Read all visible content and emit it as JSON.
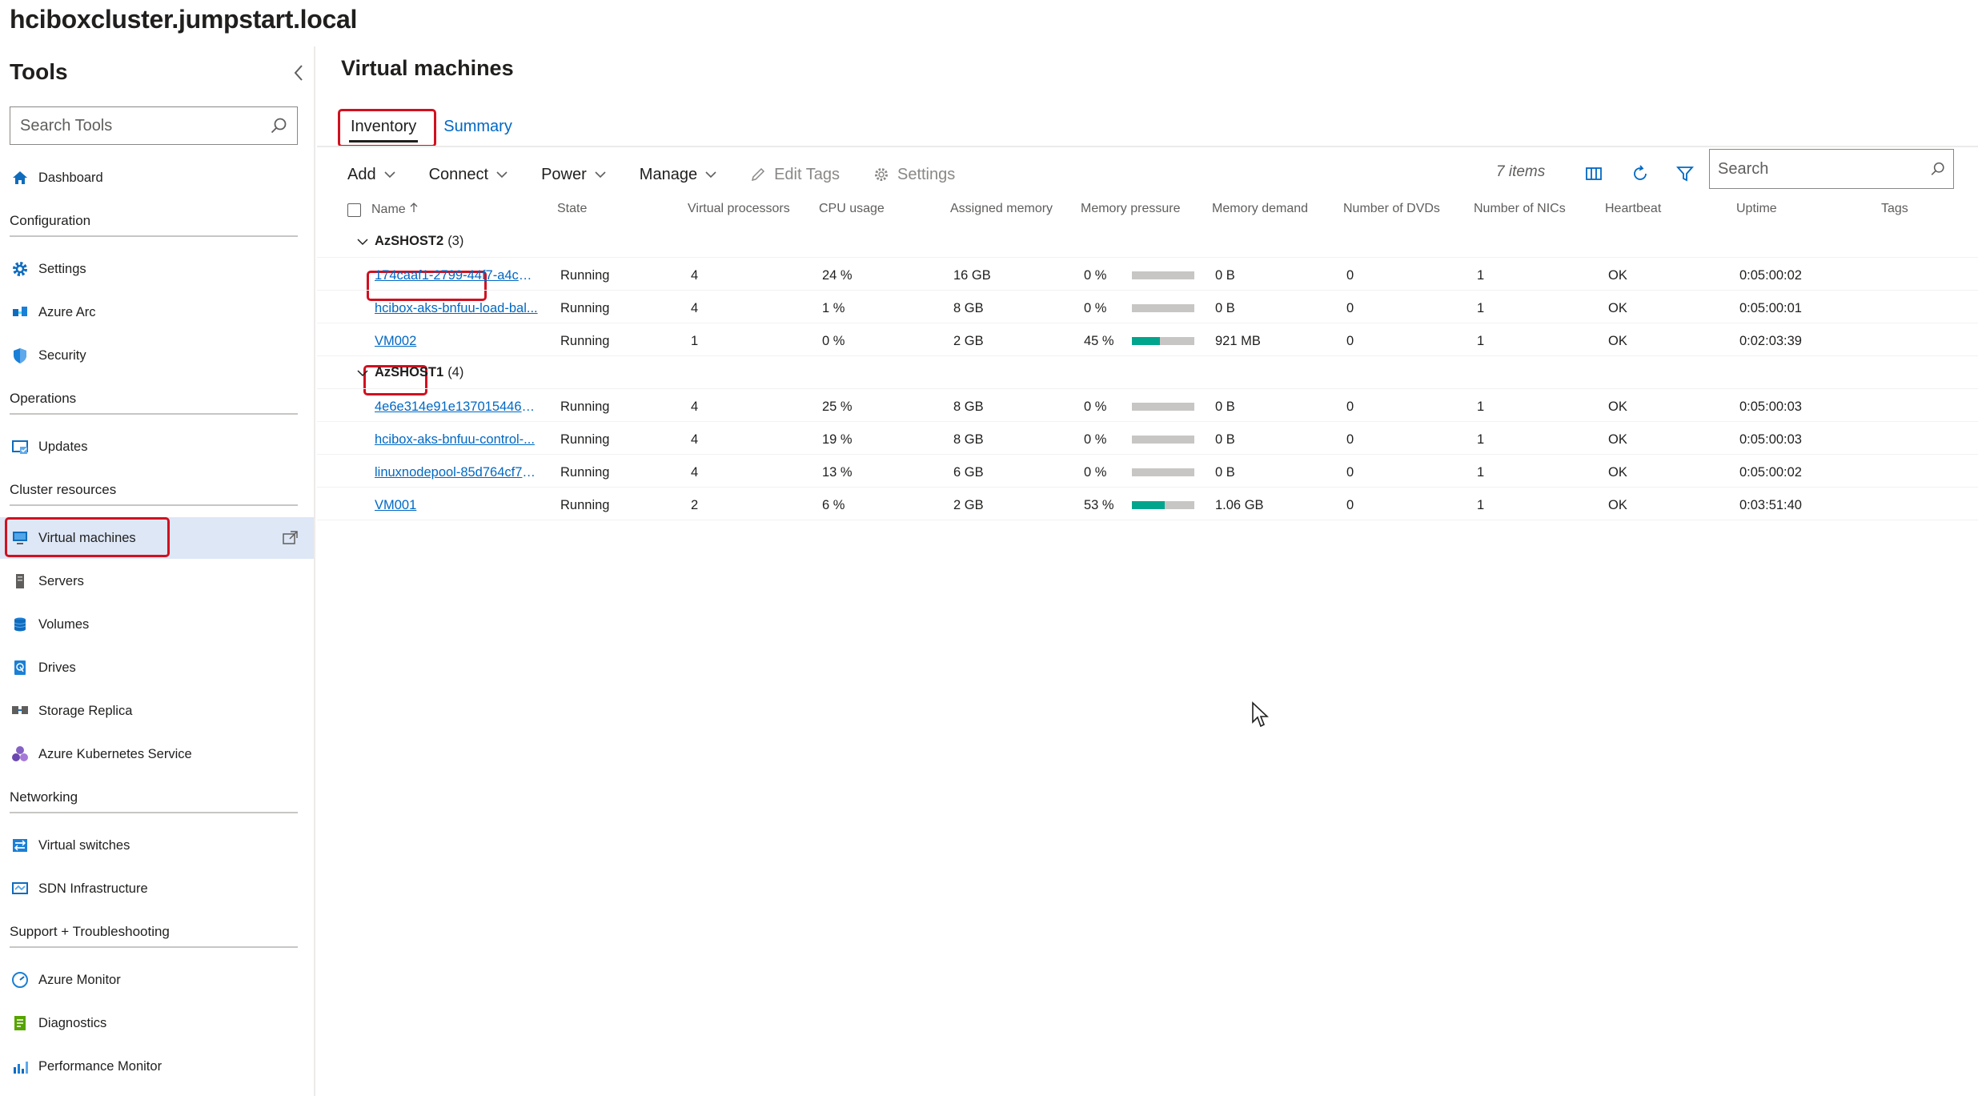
{
  "app": {
    "title": "hciboxcluster.jumpstart.local"
  },
  "sidebar": {
    "title": "Tools",
    "search_placeholder": "Search Tools",
    "items": {
      "dashboard": "Dashboard",
      "section_configuration": "Configuration",
      "settings": "Settings",
      "azure_arc": "Azure Arc",
      "security": "Security",
      "section_operations": "Operations",
      "updates": "Updates",
      "section_cluster_resources": "Cluster resources",
      "virtual_machines": "Virtual machines",
      "servers": "Servers",
      "volumes": "Volumes",
      "drives": "Drives",
      "storage_replica": "Storage Replica",
      "aks": "Azure Kubernetes Service",
      "section_networking": "Networking",
      "virtual_switches": "Virtual switches",
      "sdn_infrastructure": "SDN Infrastructure",
      "section_support": "Support + Troubleshooting",
      "azure_monitor": "Azure Monitor",
      "diagnostics": "Diagnostics",
      "performance_monitor": "Performance Monitor"
    }
  },
  "main": {
    "title": "Virtual machines",
    "tabs": [
      "Inventory",
      "Summary"
    ],
    "toolbar": {
      "add": "Add",
      "connect": "Connect",
      "power": "Power",
      "manage": "Manage",
      "edit_tags": "Edit Tags",
      "settings": "Settings",
      "items_count": "7 items",
      "search_placeholder": "Search"
    },
    "columns": [
      "Name",
      "State",
      "Virtual processors",
      "CPU usage",
      "Assigned memory",
      "Memory pressure",
      "Memory demand",
      "Number of DVDs",
      "Number of NICs",
      "Heartbeat",
      "Uptime",
      "Tags"
    ],
    "groups": [
      {
        "name": "AzSHOST2",
        "count": "(3)",
        "rows": [
          {
            "name": "174caaf1-2799-44f7-a4c6-...",
            "state": "Running",
            "vcpu": "4",
            "cpu": "24 %",
            "mem": "16 GB",
            "pressure": "0 %",
            "pressure_value": 0,
            "demand": "0 B",
            "dvds": "0",
            "nics": "1",
            "heartbeat": "OK",
            "uptime": "0:05:00:02"
          },
          {
            "name": "hcibox-aks-bnfuu-load-bal...",
            "state": "Running",
            "vcpu": "4",
            "cpu": "1 %",
            "mem": "8 GB",
            "pressure": "0 %",
            "pressure_value": 0,
            "demand": "0 B",
            "dvds": "0",
            "nics": "1",
            "heartbeat": "OK",
            "uptime": "0:05:00:01"
          },
          {
            "name": "VM002",
            "state": "Running",
            "vcpu": "1",
            "cpu": "0 %",
            "mem": "2 GB",
            "pressure": "45 %",
            "pressure_value": 45,
            "demand": "921 MB",
            "dvds": "0",
            "nics": "1",
            "heartbeat": "OK",
            "uptime": "0:02:03:39"
          }
        ]
      },
      {
        "name": "AzSHOST1",
        "count": "(4)",
        "rows": [
          {
            "name": "4e6e314e91e13701544669...",
            "state": "Running",
            "vcpu": "4",
            "cpu": "25 %",
            "mem": "8 GB",
            "pressure": "0 %",
            "pressure_value": 0,
            "demand": "0 B",
            "dvds": "0",
            "nics": "1",
            "heartbeat": "OK",
            "uptime": "0:05:00:03"
          },
          {
            "name": "hcibox-aks-bnfuu-control-...",
            "state": "Running",
            "vcpu": "4",
            "cpu": "19 %",
            "mem": "8 GB",
            "pressure": "0 %",
            "pressure_value": 0,
            "demand": "0 B",
            "dvds": "0",
            "nics": "1",
            "heartbeat": "OK",
            "uptime": "0:05:00:03"
          },
          {
            "name": "linuxnodepool-85d764cf79...",
            "state": "Running",
            "vcpu": "4",
            "cpu": "13 %",
            "mem": "6 GB",
            "pressure": "0 %",
            "pressure_value": 0,
            "demand": "0 B",
            "dvds": "0",
            "nics": "1",
            "heartbeat": "OK",
            "uptime": "0:05:00:02"
          },
          {
            "name": "VM001",
            "state": "Running",
            "vcpu": "2",
            "cpu": "6 %",
            "mem": "2 GB",
            "pressure": "53 %",
            "pressure_value": 53,
            "demand": "1.06 GB",
            "dvds": "0",
            "nics": "1",
            "heartbeat": "OK",
            "uptime": "0:03:51:40"
          }
        ]
      }
    ]
  },
  "colors": {
    "accent": "#0068c4",
    "highlight": "#d1101f",
    "pressure_fill": "#00a58e",
    "active_nav": "#dde7f6"
  }
}
